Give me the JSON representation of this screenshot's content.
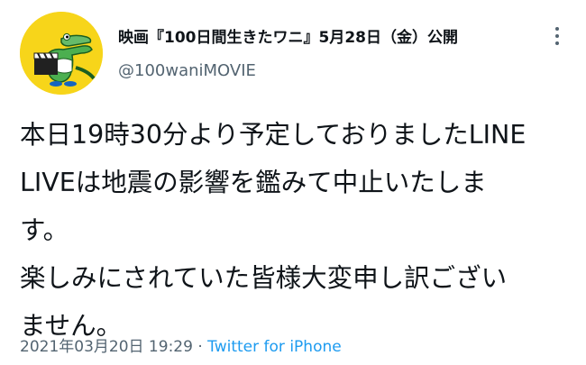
{
  "user": {
    "display_name": "映画『100日間生きたワニ』5月28日（金）公開",
    "handle": "@100waniMOVIE",
    "avatar_icon": "crocodile-clapperboard-avatar",
    "avatar_bg": "#f7d51a"
  },
  "more_icon": "more-vertical-icon",
  "tweet": {
    "lines": [
      "本日19時30分より予定しておりましたLINE",
      "LIVEは地震の影響を鑑みて中止いたしま",
      "す。",
      "楽しみにされていた皆様大変申し訳ござい",
      "ません。"
    ],
    "timestamp": "2021年03月20日 19:29",
    "separator": " · ",
    "source": "Twitter for iPhone"
  },
  "colors": {
    "text": "#0f1419",
    "secondary": "#536471",
    "link": "#1d9bf0"
  }
}
